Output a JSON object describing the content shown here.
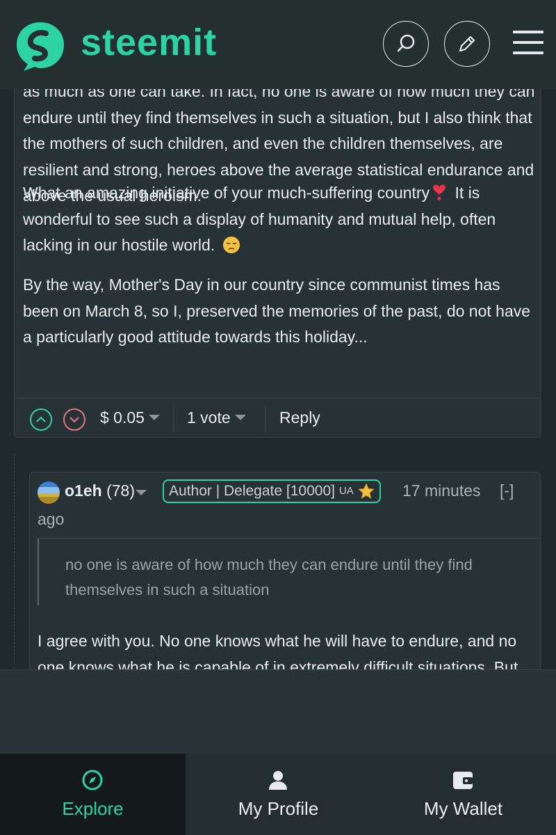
{
  "header": {
    "brand": "steemit"
  },
  "comment": {
    "paragraphs": [
      "as much as one can take. In fact, no one is aware of how much they can endure until they find themselves in such a situation, but I also think that the mothers of such children, and even the children themselves, are resilient and strong, heroes above the average statistical endurance and above the usual heroism.",
      "What an amazing initiative of your much-suffering country",
      "It is wonderful to see such a display of humanity and mutual help, often lacking in our hostile world.",
      "By the way, Mother's Day in our country since communist times has been on March 8, so I, preserved the memories of the past, do not have a particularly good attitude towards this holiday..."
    ],
    "payout": "$ 0.05",
    "votes": "1 vote",
    "reply_label": "Reply"
  },
  "reply_comment": {
    "author": "o1eh",
    "reputation": "(78)",
    "badge": "Author | Delegate [10000]",
    "badge_flag": "UA",
    "time": "17 minutes",
    "time_suffix": "ago",
    "collapse": "[-]",
    "quote": "no one is aware of how much they can endure until they find themselves in such a situation",
    "body": "I agree with you. No one knows what he will have to endure, and no one knows what he is capable of in extremely difficult situations. But"
  },
  "bottom_nav": {
    "explore": "Explore",
    "profile": "My Profile",
    "wallet": "My Wallet"
  },
  "colors": {
    "accent": "#2ed3a2",
    "background": "#1f2a2e",
    "card": "#263236",
    "downvote": "#e07a7a"
  }
}
